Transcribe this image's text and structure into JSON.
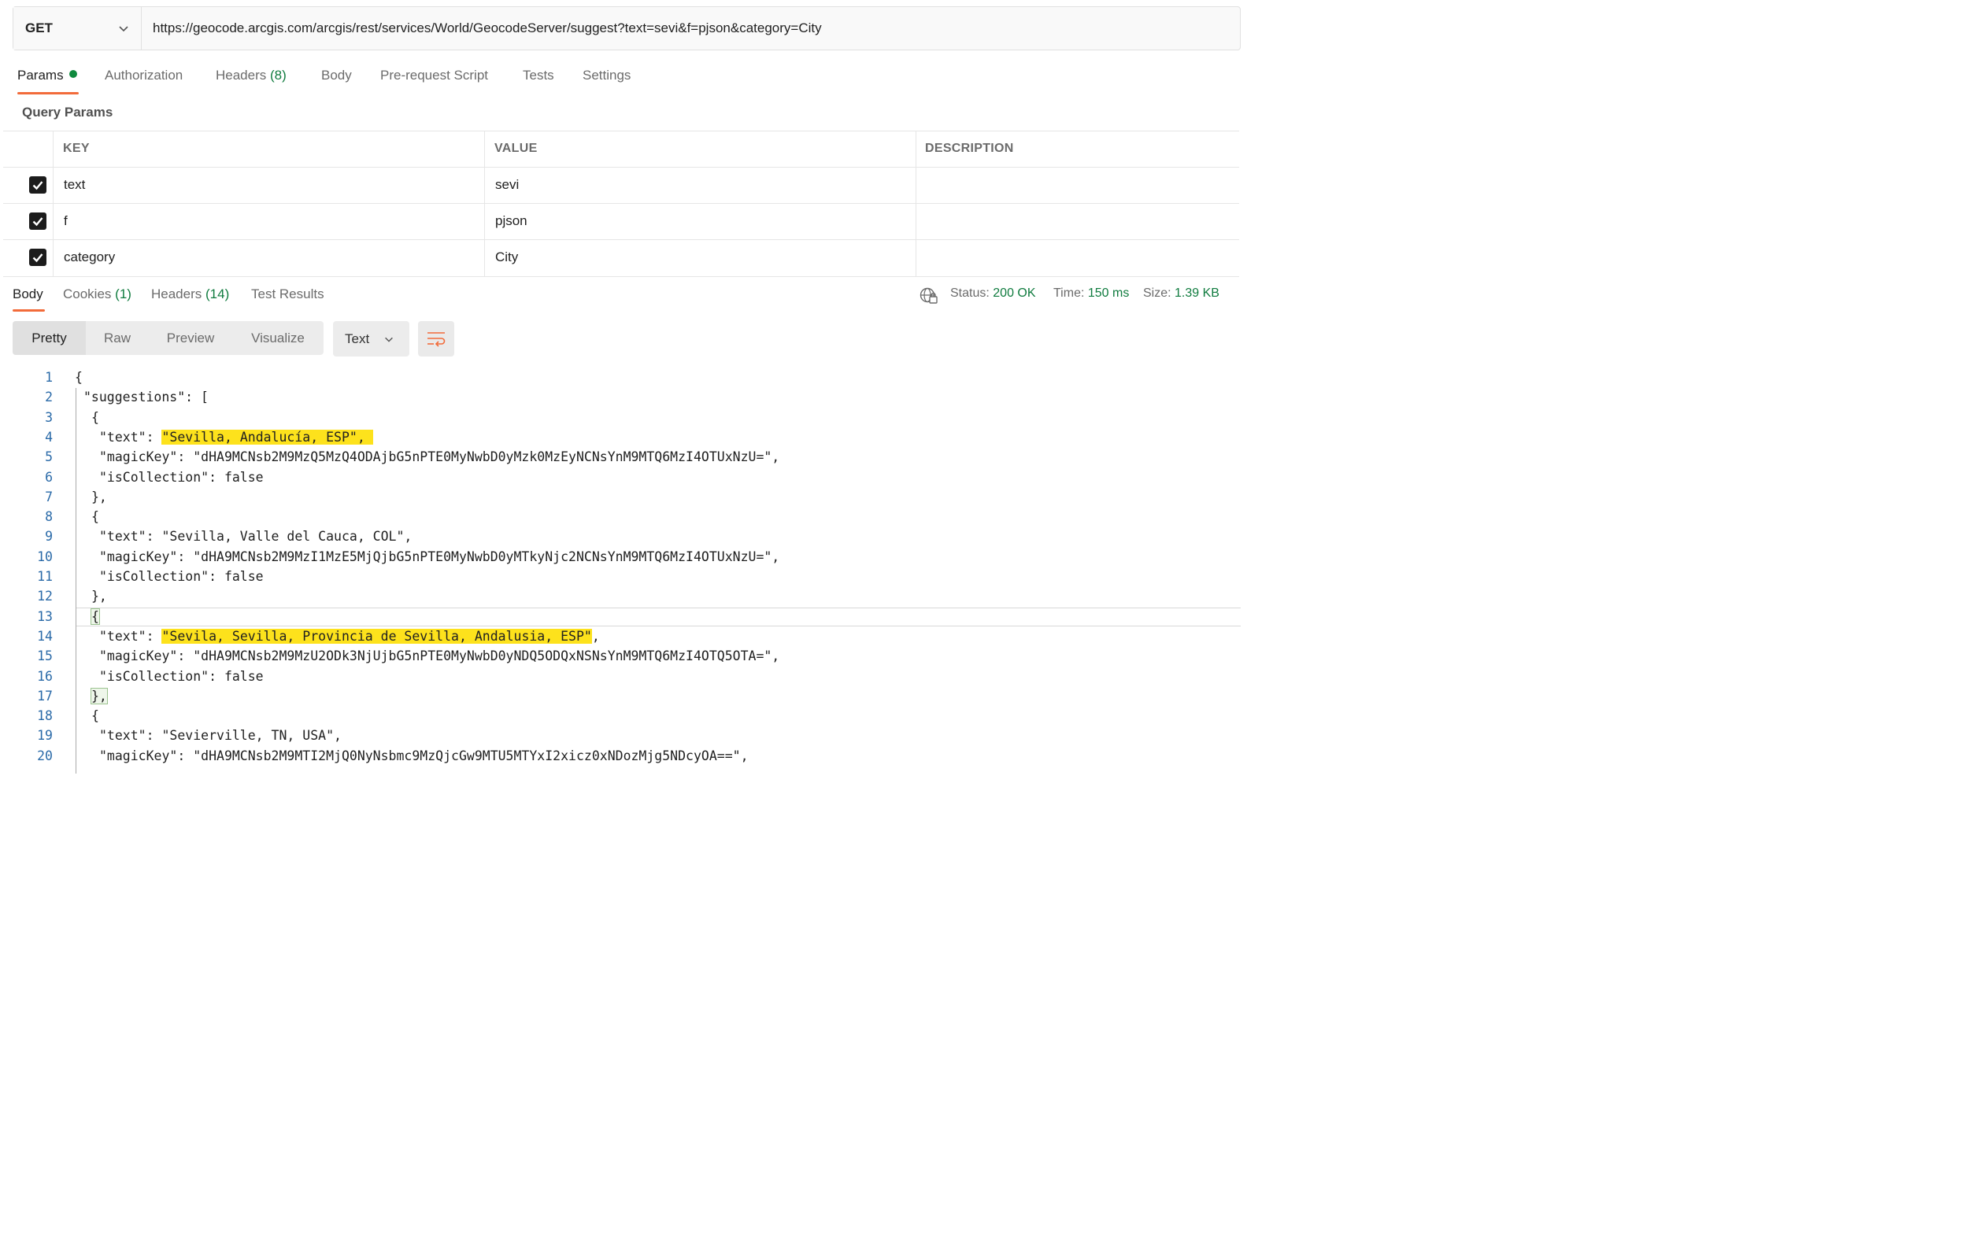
{
  "request": {
    "method": "GET",
    "url": "https://geocode.arcgis.com/arcgis/rest/services/World/GeocodeServer/suggest?text=sevi&f=pjson&category=City"
  },
  "request_tabs": [
    {
      "label": "Params",
      "count": ""
    },
    {
      "label": "Authorization",
      "count": ""
    },
    {
      "label": "Headers",
      "count": "(8)"
    },
    {
      "label": "Body",
      "count": ""
    },
    {
      "label": "Pre-request Script",
      "count": ""
    },
    {
      "label": "Tests",
      "count": ""
    },
    {
      "label": "Settings",
      "count": ""
    }
  ],
  "query_params": {
    "title": "Query Params",
    "headers": [
      "KEY",
      "VALUE",
      "DESCRIPTION"
    ],
    "rows": [
      {
        "checked": true,
        "key": "text",
        "value": "sevi",
        "description": ""
      },
      {
        "checked": true,
        "key": "f",
        "value": "pjson",
        "description": ""
      },
      {
        "checked": true,
        "key": "category",
        "value": "City",
        "description": ""
      }
    ]
  },
  "response_tabs": [
    {
      "label": "Body",
      "count": ""
    },
    {
      "label": "Cookies",
      "count": "(1)"
    },
    {
      "label": "Headers",
      "count": "(14)"
    },
    {
      "label": "Test Results",
      "count": ""
    }
  ],
  "response_status": {
    "status_label": "Status:",
    "status_value": "200 OK",
    "time_label": "Time:",
    "time_value": "150 ms",
    "size_label": "Size:",
    "size_value": "1.39 KB"
  },
  "view_modes": [
    "Pretty",
    "Raw",
    "Preview",
    "Visualize"
  ],
  "format": "Text",
  "colors": {
    "accent": "#f26b3a",
    "success": "#0f7b3e",
    "highlight": "#fde21c",
    "line_number": "#2a6aa8"
  },
  "code_lines": [
    {
      "n": "1",
      "text": "{"
    },
    {
      "n": "2",
      "text": "\"suggestions\": ["
    },
    {
      "n": "3",
      "text": "{"
    },
    {
      "n": "4",
      "pre": "\"text\": ",
      "hl": "\"Sevilla, Andalucía, ESP\", ",
      "post": ""
    },
    {
      "n": "5",
      "text": "\"magicKey\": \"dHA9MCNsb2M9MzQ5MzQ4ODAjbG5nPTE0MyNwbD0yMzk0MzEyNCNsYnM9MTQ6MzI4OTUxNzU=\","
    },
    {
      "n": "6",
      "text": "\"isCollection\": false"
    },
    {
      "n": "7",
      "text": "},"
    },
    {
      "n": "8",
      "text": "{"
    },
    {
      "n": "9",
      "text": "\"text\": \"Sevilla, Valle del Cauca, COL\","
    },
    {
      "n": "10",
      "text": "\"magicKey\": \"dHA9MCNsb2M9MzI1MzE5MjQjbG5nPTE0MyNwbD0yMTkyNjc2NCNsYnM9MTQ6MzI4OTUxNzU=\","
    },
    {
      "n": "11",
      "text": "\"isCollection\": false"
    },
    {
      "n": "12",
      "text": "},"
    },
    {
      "n": "13",
      "text": "{"
    },
    {
      "n": "14",
      "pre": "\"text\": ",
      "hl": "\"Sevila, Sevilla, Provincia de Sevilla, Andalusia, ESP\"",
      "post": ","
    },
    {
      "n": "15",
      "text": "\"magicKey\": \"dHA9MCNsb2M9MzU2ODk3NjUjbG5nPTE0MyNwbD0yNDQ5ODQxNSNsYnM9MTQ6MzI4OTQ5OTA=\","
    },
    {
      "n": "16",
      "text": "\"isCollection\": false"
    },
    {
      "n": "17",
      "text": "},"
    },
    {
      "n": "18",
      "text": "{"
    },
    {
      "n": "19",
      "text": "\"text\": \"Sevierville, TN, USA\","
    },
    {
      "n": "20",
      "text": "\"magicKey\": \"dHA9MCNsb2M9MTI2MjQ0NyNsbmc9MzQjcGw9MTU5MTYxI2xicz0xNDozMjg5NDcyOA==\","
    }
  ]
}
